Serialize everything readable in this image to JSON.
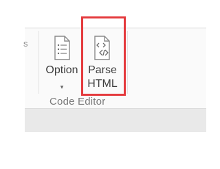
{
  "ribbon": {
    "left_fragment": "s",
    "group_label": "Code Editor",
    "buttons": [
      {
        "label": "Option",
        "icon": "document-list-icon",
        "has_dropdown": true,
        "dropdown_glyph": "▾"
      },
      {
        "label_line1": "Parse",
        "label_line2": "HTML",
        "icon": "document-code-icon",
        "highlighted": true
      }
    ]
  },
  "colors": {
    "highlight": "#e43a3d",
    "text": "#3e3e3e",
    "group_label": "#7a7a7a"
  }
}
